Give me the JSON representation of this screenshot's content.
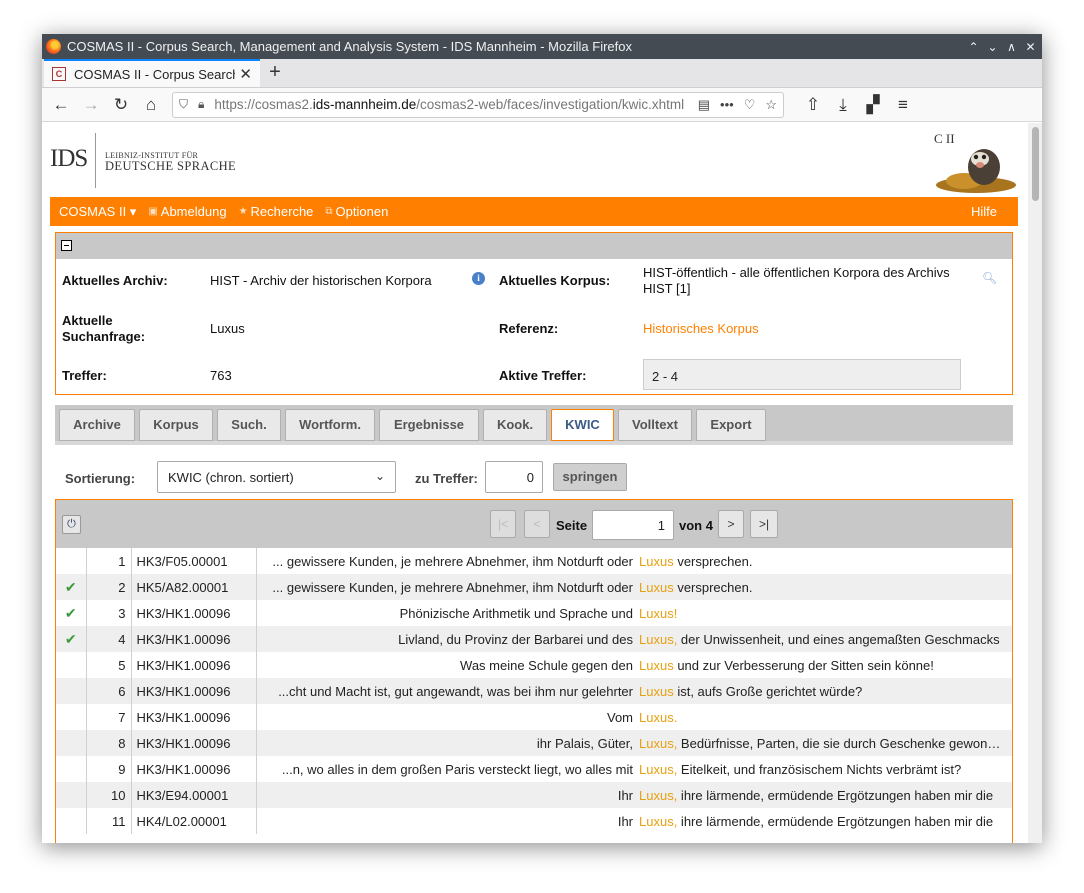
{
  "window": {
    "title": "COSMAS II - Corpus Search, Management and Analysis System - IDS Mannheim - Mozilla Firefox",
    "controls": [
      "⌃",
      "⌄",
      "∧",
      "✕"
    ]
  },
  "browser": {
    "tab_title": "COSMAS II - Corpus Search, Management and Analysis System",
    "favicon_text": "C",
    "new_tab": "+",
    "url_prefix": "https://cosmas2.",
    "url_domain": "ids-mannheim.de",
    "url_path": "/cosmas2-web/faces/investigation/kwic.xhtml"
  },
  "header": {
    "logo": "IDS",
    "sub_line1": "LEIBNIZ-INSTITUT FÜR",
    "sub_line2": "DEUTSCHE SPRACHE",
    "mascot_text": "C II"
  },
  "menu": {
    "cosmas": "COSMAS II ▾",
    "logout": "Abmeldung",
    "research": "Recherche",
    "options": "Optionen",
    "help": "Hilfe"
  },
  "info": {
    "archive_label": "Aktuelles Archiv:",
    "archive_value": "HIST - Archiv der historischen Korpora",
    "corpus_label": "Aktuelles Korpus:",
    "corpus_value_l1": "HIST-öffentlich - alle öffentlichen Korpora des Archivs",
    "corpus_value_l2": "HIST [1]",
    "query_label_l1": "Aktuelle",
    "query_label_l2": "Suchanfrage:",
    "query_value": "Luxus",
    "reference_label": "Referenz:",
    "reference_value": "Historisches Korpus",
    "hits_label": "Treffer:",
    "hits_value": "763",
    "active_label": "Aktive Treffer:",
    "active_value": "2 - 4"
  },
  "tabs": [
    "Archive",
    "Korpus",
    "Such.",
    "Wortform.",
    "Ergebnisse",
    "Kook.",
    "KWIC",
    "Volltext",
    "Export"
  ],
  "active_tab": "KWIC",
  "sort": {
    "label": "Sortierung:",
    "selected": "KWIC (chron. sortiert)",
    "goto_label": "zu Treffer:",
    "goto_value": "0",
    "jump_button": "springen"
  },
  "pager": {
    "first": "|<",
    "prev": "<",
    "page_label": "Seite",
    "page_value": "1",
    "of_label": "von 4",
    "next": ">",
    "last": ">|"
  },
  "rows": [
    {
      "check": "",
      "num": "1",
      "sig": "HK3/F05.00001",
      "left": "... gewissere Kunden, je mehrere Abnehmer, ihm Notdurft oder",
      "kw": "Luxus",
      "right": " versprechen."
    },
    {
      "check": "✔",
      "num": "2",
      "sig": "HK5/A82.00001",
      "left": "... gewissere Kunden, je mehrere Abnehmer, ihm Notdurft oder",
      "kw": "Luxus",
      "right": " versprechen."
    },
    {
      "check": "✔",
      "num": "3",
      "sig": "HK3/HK1.00096",
      "left": "Phönizische Arithmetik und Sprache und",
      "kw": "Luxus!",
      "right": ""
    },
    {
      "check": "✔",
      "num": "4",
      "sig": "HK3/HK1.00096",
      "left": "Livland, du Provinz der Barbarei und des",
      "kw": "Luxus,",
      "right": " der Unwissenheit, und eines angemaßten Geschmacks"
    },
    {
      "check": "",
      "num": "5",
      "sig": "HK3/HK1.00096",
      "left": "Was meine Schule gegen den",
      "kw": "Luxus",
      "right": " und zur Verbesserung der Sitten sein könne!"
    },
    {
      "check": "",
      "num": "6",
      "sig": "HK3/HK1.00096",
      "left": "...cht und Macht ist, gut angewandt, was bei ihm nur gelehrter",
      "kw": "Luxus",
      "right": " ist, aufs Große gerichtet würde?"
    },
    {
      "check": "",
      "num": "7",
      "sig": "HK3/HK1.00096",
      "left": "Vom",
      "kw": "Luxus.",
      "right": ""
    },
    {
      "check": "",
      "num": "8",
      "sig": "HK3/HK1.00096",
      "left": "ihr Palais, Güter,",
      "kw": "Luxus,",
      "right": " Bedürfnisse, Parten, die sie durch Geschenke gewonnen"
    },
    {
      "check": "",
      "num": "9",
      "sig": "HK3/HK1.00096",
      "left": "...n, wo alles in dem großen Paris versteckt liegt, wo alles mit",
      "kw": "Luxus,",
      "right": " Eitelkeit, und französischem Nichts verbrämt ist?"
    },
    {
      "check": "",
      "num": "10",
      "sig": "HK3/E94.00001",
      "left": "Ihr",
      "kw": "Luxus,",
      "right": " ihre lärmende, ermüdende Ergötzungen haben mir die"
    },
    {
      "check": "",
      "num": "11",
      "sig": "HK4/L02.00001",
      "left": "Ihr",
      "kw": "Luxus,",
      "right": " ihre lärmende, ermüdende Ergötzungen haben mir die"
    }
  ]
}
